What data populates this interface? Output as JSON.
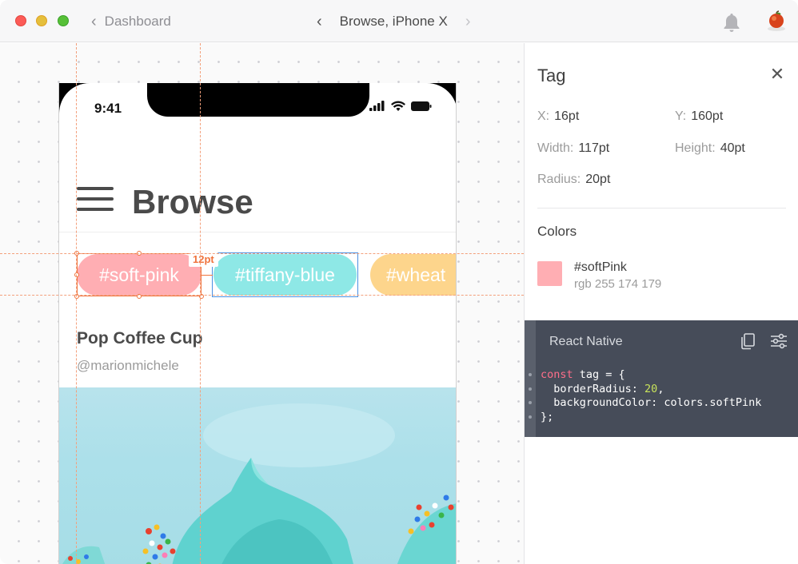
{
  "titlebar": {
    "back_label": "Dashboard",
    "title": "Browse, iPhone X"
  },
  "phone": {
    "status_time": "9:41",
    "page_title": "Browse",
    "tags": [
      {
        "label": "#soft-pink",
        "color": "#ffaeb3"
      },
      {
        "label": "#tiffany-blue",
        "color": "#8ee8e6"
      },
      {
        "label": "#wheat",
        "color": "#fdd58c"
      }
    ],
    "spacing_label": "12pt",
    "card": {
      "title": "Pop Coffee Cup",
      "author": "@marionmichele"
    }
  },
  "inspector": {
    "title": "Tag",
    "props": {
      "x_label": "X:",
      "x_value": "16pt",
      "y_label": "Y:",
      "y_value": "160pt",
      "width_label": "Width:",
      "width_value": "117pt",
      "height_label": "Height:",
      "height_value": "40pt",
      "radius_label": "Radius:",
      "radius_value": "20pt"
    },
    "colors_heading": "Colors",
    "color": {
      "name": "#softPink",
      "rgb": "rgb 255 174 179",
      "hex": "#ffaeb3"
    },
    "code": {
      "header": "React Native",
      "line1_kw": "const",
      "line1_rest": " tag = {",
      "line2_key": "  borderRadius: ",
      "line2_num": "20",
      "line2_end": ",",
      "line3": "  backgroundColor: colors.softPink",
      "line4": "};"
    }
  },
  "colors": {
    "accent_orange": "#f0733c",
    "selection_blue": "#4a90e2",
    "code_bg": "#464c59"
  }
}
